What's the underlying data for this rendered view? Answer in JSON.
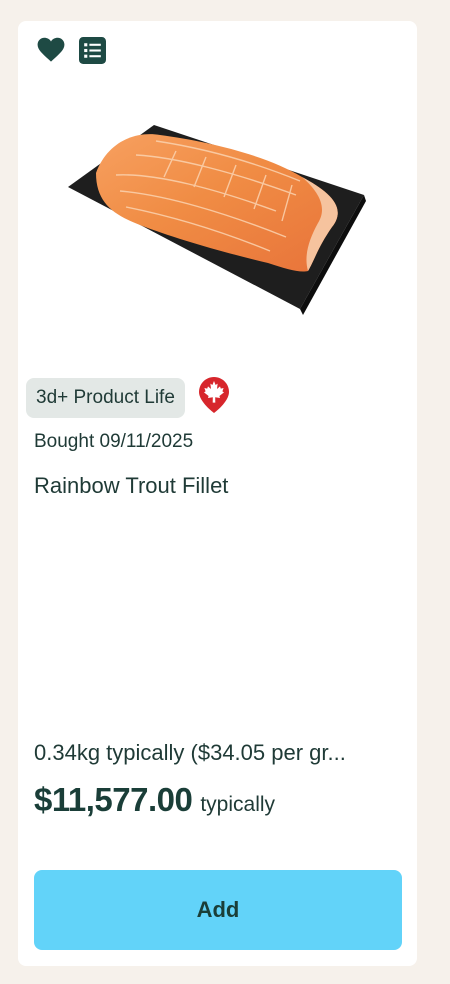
{
  "icons": {
    "favorite": "heart-icon",
    "list": "list-icon",
    "origin": "maple-leaf-icon"
  },
  "product": {
    "image_alt": "Rainbow trout fillet on a black slate board",
    "life_badge": "3d+ Product Life",
    "bought": "Bought 09/11/2025",
    "name": "Rainbow Trout Fillet",
    "weight_line": "0.34kg typically  ($34.05 per gr...",
    "price": "$11,577.00",
    "price_qualifier": "typically"
  },
  "actions": {
    "add_label": "Add"
  },
  "colors": {
    "background": "#f6f1eb",
    "card": "#ffffff",
    "primary_text": "#1f3a36",
    "icon": "#1e4a44",
    "add_button": "#62d3f9",
    "badge": "#e3e8e6",
    "canada_red": "#d7262c"
  }
}
